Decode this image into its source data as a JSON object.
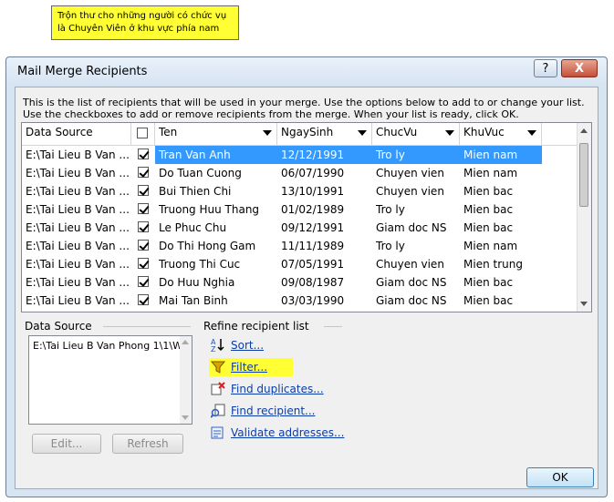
{
  "note": {
    "line1": "Trộn thư cho những người có chức vụ",
    "line2": "là Chuyên Viên ở khu vực phía nam"
  },
  "dialog": {
    "title": "Mail Merge Recipients",
    "help_label": "?",
    "close_label": "X",
    "instruction": "This is the list of recipients that will be used in your merge.  Use the options below to add to or change your list.  Use the checkboxes to add or remove recipients from the merge.  When your list is ready, click OK."
  },
  "table": {
    "columns": [
      "Data Source",
      "",
      "Ten",
      "NgaySinh",
      "ChucVu",
      "KhuVuc"
    ],
    "rows": [
      {
        "source": "E:\\Tai Lieu B Van ...",
        "name": "Tran Van Anh",
        "dob": "12/12/1991",
        "role": "Tro ly",
        "region": "Mien nam"
      },
      {
        "source": "E:\\Tai Lieu B Van ...",
        "name": "Do Tuan Cuong",
        "dob": "06/07/1990",
        "role": "Chuyen vien",
        "region": "Mien nam"
      },
      {
        "source": "E:\\Tai Lieu B Van ...",
        "name": "Bui Thien Chi",
        "dob": "13/10/1991",
        "role": "Chuyen vien",
        "region": "Mien bac"
      },
      {
        "source": "E:\\Tai Lieu B Van ...",
        "name": "Truong Huu Thang",
        "dob": "01/02/1989",
        "role": "Tro ly",
        "region": "Mien bac"
      },
      {
        "source": "E:\\Tai Lieu B Van ...",
        "name": "Le Phuc Chu",
        "dob": "09/12/1991",
        "role": "Giam doc NS",
        "region": "Mien bac"
      },
      {
        "source": "E:\\Tai Lieu B Van ...",
        "name": "Do Thi Hong Gam",
        "dob": "11/11/1989",
        "role": "Tro ly",
        "region": "Mien nam"
      },
      {
        "source": "E:\\Tai Lieu B Van ...",
        "name": "Truong Thi Cuc",
        "dob": "07/05/1991",
        "role": "Chuyen vien",
        "region": "Mien trung"
      },
      {
        "source": "E:\\Tai Lieu B Van ...",
        "name": "Do Huu Nghia",
        "dob": "09/08/1987",
        "role": "Giam doc NS",
        "region": "Mien bac"
      },
      {
        "source": "E:\\Tai Lieu B Van ...",
        "name": "Mai Tan Binh",
        "dob": "03/03/1990",
        "role": "Giam doc NS",
        "region": "Mien bac"
      }
    ]
  },
  "data_source": {
    "label": "Data Source",
    "item": "E:\\Tai Lieu B Van Phong 1\\1\\W",
    "edit_label": "Edit...",
    "refresh_label": "Refresh"
  },
  "refine": {
    "label": "Refine recipient list",
    "sort": "Sort...",
    "filter": "Filter...",
    "find_duplicates": "Find duplicates...",
    "find_recipient": "Find recipient...",
    "validate": "Validate addresses..."
  },
  "ok_label": "OK",
  "colors": {
    "selection": "#3399ff",
    "highlight": "#ffff33",
    "link": "#0b3ca8"
  }
}
